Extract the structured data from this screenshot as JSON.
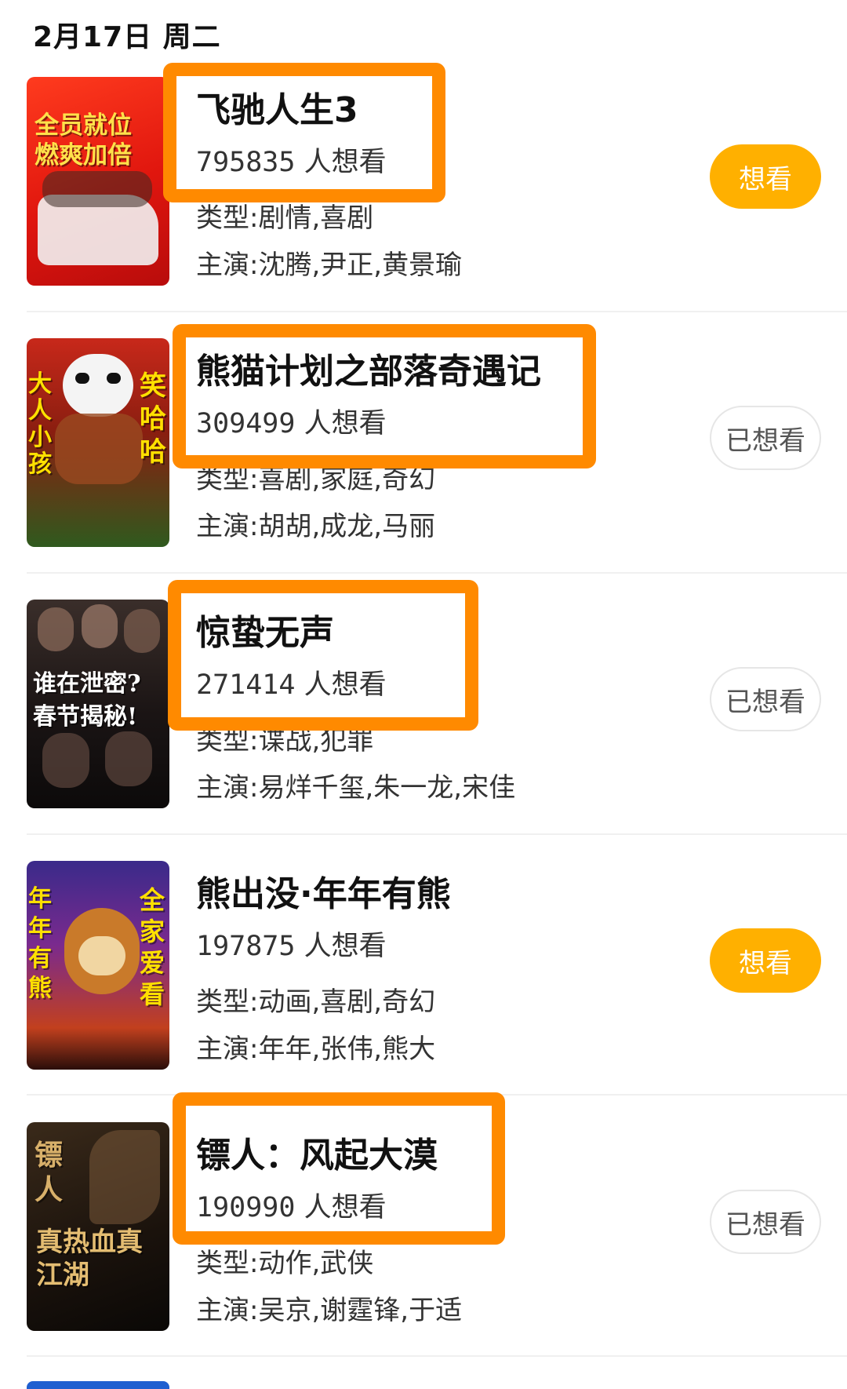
{
  "header": {
    "date": "2月17日 周二"
  },
  "colors": {
    "highlight": "#ff8a00",
    "primary_button": "#ffb000"
  },
  "movies": [
    {
      "title": "飞驰人生3",
      "want_count": "795835",
      "want_suffix": " 人想看",
      "genre": "类型:剧情,喜剧",
      "cast": "主演:沈腾,尹正,黄景瑜",
      "button": "想看",
      "button_state": "want",
      "poster_lines": [
        "全员就位",
        "燃爽加倍"
      ]
    },
    {
      "title": "熊猫计划之部落奇遇记",
      "want_count": "309499",
      "want_suffix": " 人想看",
      "genre": "类型:喜剧,家庭,奇幻",
      "cast": "主演:胡胡,成龙,马丽",
      "button": "已想看",
      "button_state": "wanted",
      "poster_lines": [
        "大人小孩",
        "笑哈哈"
      ]
    },
    {
      "title": "惊蛰无声",
      "want_count": "271414",
      "want_suffix": " 人想看",
      "genre": "类型:谍战,犯罪",
      "cast": "主演:易烊千玺,朱一龙,宋佳",
      "button": "已想看",
      "button_state": "wanted",
      "poster_lines": [
        "谁在泄密?",
        "春节揭秘!"
      ]
    },
    {
      "title": "熊出没·年年有熊",
      "want_count": "197875",
      "want_suffix": " 人想看",
      "genre": "类型:动画,喜剧,奇幻",
      "cast": "主演:年年,张伟,熊大",
      "button": "想看",
      "button_state": "want",
      "poster_lines": [
        "年年有熊",
        "全家爱看"
      ]
    },
    {
      "title": "镖人：风起大漠",
      "want_count": "190990",
      "want_suffix": " 人想看",
      "genre": "类型:动作,武侠",
      "cast": "主演:吴京,谢霆锋,于适",
      "button": "已想看",
      "button_state": "wanted",
      "poster_lines": [
        "镖人",
        "真热血真江湖"
      ]
    }
  ]
}
